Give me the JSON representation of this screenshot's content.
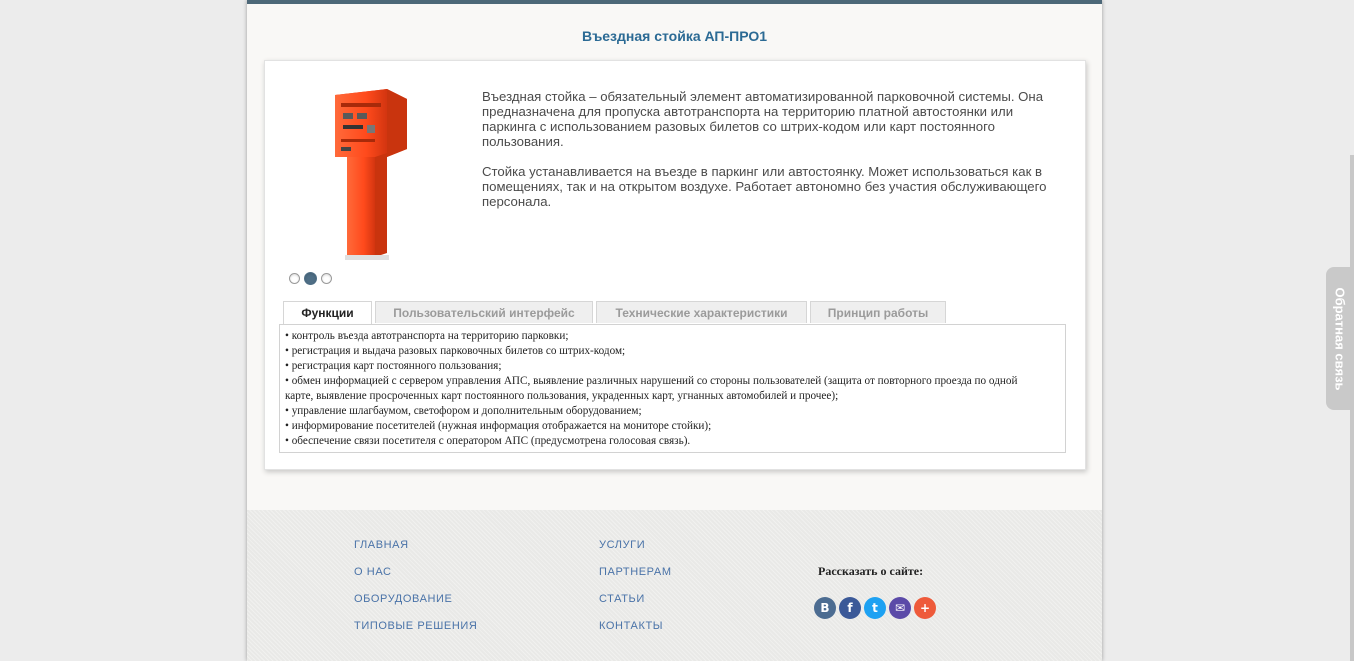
{
  "page": {
    "title": "Въездная стойка АП-ПРО1"
  },
  "product": {
    "image_icon": "parking-entry-terminal-image",
    "color": "#ff4a1c",
    "slider_dots": 3,
    "active_dot": 2,
    "description": [
      "Въездная стойка – обязательный элемент автоматизированной парковочной системы. Она предназначена для пропуска автотранспорта на территорию платной автостоянки или паркинга с использованием разовых билетов со штрих-кодом или карт постоянного пользования.",
      "Стойка устанавливается на въезде в паркинг или автостоянку. Может использоваться как в помещениях, так и на открытом воздухе. Работает автономно без участия обслуживающего персонала."
    ]
  },
  "tabs": [
    {
      "label": "Функции",
      "active": true
    },
    {
      "label": "Пользовательский интерфейс",
      "active": false
    },
    {
      "label": "Технические характеристики",
      "active": false
    },
    {
      "label": "Принцип работы",
      "active": false
    }
  ],
  "functions": [
    "• контроль въезда автотранспорта на территорию парковки;",
    "• регистрация и выдача разовых парковочных билетов со штрих-кодом;",
    "• регистрация карт постоянного пользования;",
    "• обмен информацией с сервером управления АПС, выявление различных нарушений со стороны пользователей (защита от повторного проезда по одной",
    "карте, выявление просроченных карт постоянного пользования, украденных карт, угнанных автомобилей и прочее);",
    "• управление шлагбаумом, светофором и дополнительным оборудованием;",
    "• информирование посетителей (нужная информация отображается на мониторе стойки);",
    "• обеспечение связи посетителя с оператором АПС (предусмотрена голосовая связь)."
  ],
  "footer": {
    "col1": [
      "ГЛАВНАЯ",
      "О НАС",
      "ОБОРУДОВАНИЕ",
      "ТИПОВЫЕ РЕШЕНИЯ"
    ],
    "col2": [
      "УСЛУГИ",
      "ПАРТНЕРАМ",
      "СТАТЬИ",
      "КОНТАКТЫ"
    ],
    "share_label": "Рассказать о сайте:",
    "share_icons": [
      {
        "name": "vk-icon",
        "glyph": "B",
        "color": "#4c6c91"
      },
      {
        "name": "facebook-icon",
        "glyph": "f",
        "color": "#3b5998"
      },
      {
        "name": "twitter-icon",
        "glyph": "t",
        "color": "#1da1f2"
      },
      {
        "name": "mail-icon",
        "glyph": "✉",
        "color": "#5b4aa8"
      },
      {
        "name": "more-icon",
        "glyph": "+",
        "color": "#ee5a3a"
      }
    ]
  },
  "feedback": {
    "label": "Обратная связь"
  }
}
